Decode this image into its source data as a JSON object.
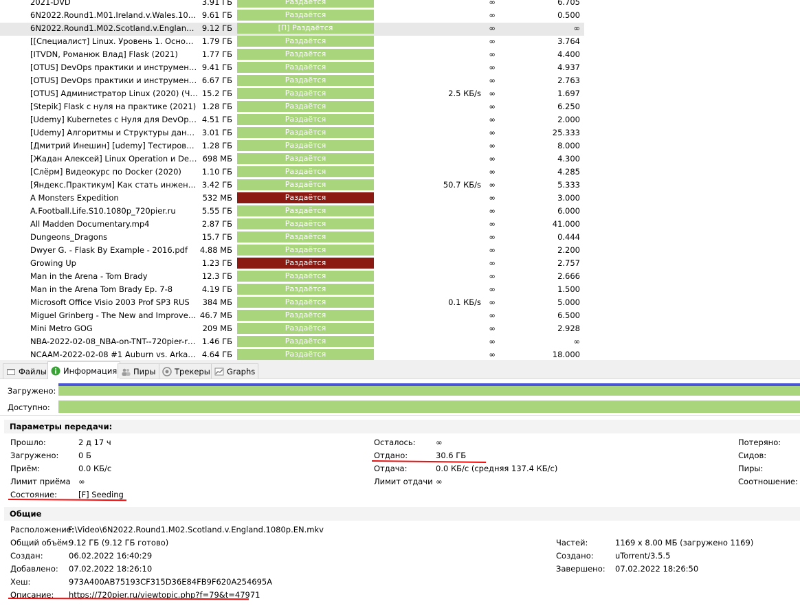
{
  "torrents": [
    {
      "name": "2021-DVD",
      "size": "3.91 ГБ",
      "status": "Раздаётся",
      "status_kind": "ok",
      "up": "",
      "eta": "∞",
      "ratio": "6.705"
    },
    {
      "name": "6N2022.Round1.M01.Ireland.v.Wales.1080p....",
      "size": "9.61 ГБ",
      "status": "Раздаётся",
      "status_kind": "ok",
      "up": "",
      "eta": "∞",
      "ratio": "0.500"
    },
    {
      "name": "6N2022.Round1.M02.Scotland.v.England.10...",
      "size": "9.12 ГБ",
      "status": "[П] Раздаётся",
      "status_kind": "ok",
      "up": "",
      "eta": "∞",
      "ratio": "∞",
      "selected": true
    },
    {
      "name": "[[Специалист] Linux. Уровень 1. Основы а...",
      "size": "1.79 ГБ",
      "status": "Раздаётся",
      "status_kind": "ok",
      "up": "",
      "eta": "∞",
      "ratio": "3.764"
    },
    {
      "name": "[ITVDN, Романюк Влад] Flask (2021)",
      "size": "1.77 ГБ",
      "status": "Раздаётся",
      "status_kind": "ok",
      "up": "",
      "eta": "∞",
      "ratio": "4.400"
    },
    {
      "name": "[OTUS] DevOps практики и инструменты",
      "size": "9.41 ГБ",
      "status": "Раздаётся",
      "status_kind": "ok",
      "up": "",
      "eta": "∞",
      "ratio": "4.937"
    },
    {
      "name": "[OTUS] DevOps практики и инструменты (...",
      "size": "6.67 ГБ",
      "status": "Раздаётся",
      "status_kind": "ok",
      "up": "",
      "eta": "∞",
      "ratio": "2.763"
    },
    {
      "name": "[OTUS] Администратор Linux (2020) (Часть...",
      "size": "15.2 ГБ",
      "status": "Раздаётся",
      "status_kind": "ok",
      "up": "2.5 КБ/s",
      "eta": "∞",
      "ratio": "1.697"
    },
    {
      "name": "[Stepik] Flask с нуля на практике (2021)",
      "size": "1.28 ГБ",
      "status": "Раздаётся",
      "status_kind": "ok",
      "up": "",
      "eta": "∞",
      "ratio": "6.250"
    },
    {
      "name": "[Udemy] Kubernetes с Нуля для DevOps И...",
      "size": "4.51 ГБ",
      "status": "Раздаётся",
      "status_kind": "ok",
      "up": "",
      "eta": "∞",
      "ratio": "2.000"
    },
    {
      "name": "[Udemy] Алгоритмы и Структуры данных ...",
      "size": "3.01 ГБ",
      "status": "Раздаётся",
      "status_kind": "ok",
      "up": "",
      "eta": "∞",
      "ratio": "25.333"
    },
    {
      "name": "[Дмитрий Инешин] [udemy] Тестировани...",
      "size": "1.28 ГБ",
      "status": "Раздаётся",
      "status_kind": "ok",
      "up": "",
      "eta": "∞",
      "ratio": "8.000"
    },
    {
      "name": "[Жадан Алексей] Linux Operation и DevOp...",
      "size": "698 МБ",
      "status": "Раздаётся",
      "status_kind": "ok",
      "up": "",
      "eta": "∞",
      "ratio": "4.300"
    },
    {
      "name": "[Слёрм] Видеокурс по Docker (2020)",
      "size": "1.10 ГБ",
      "status": "Раздаётся",
      "status_kind": "ok",
      "up": "",
      "eta": "∞",
      "ratio": "4.285"
    },
    {
      "name": "[Яндекс.Практикум] Как стать инженером...",
      "size": "3.42 ГБ",
      "status": "Раздаётся",
      "status_kind": "ok",
      "up": "50.7 КБ/s",
      "eta": "∞",
      "ratio": "5.333"
    },
    {
      "name": "A Monsters Expedition",
      "size": "532 МБ",
      "status": "Раздаётся",
      "status_kind": "err",
      "up": "",
      "eta": "∞",
      "ratio": "3.000"
    },
    {
      "name": "A.Football.Life.S10.1080p_720pier.ru",
      "size": "5.55 ГБ",
      "status": "Раздаётся",
      "status_kind": "ok",
      "up": "",
      "eta": "∞",
      "ratio": "6.000"
    },
    {
      "name": "All Madden Documentary.mp4",
      "size": "2.87 ГБ",
      "status": "Раздаётся",
      "status_kind": "ok",
      "up": "",
      "eta": "∞",
      "ratio": "41.000"
    },
    {
      "name": "Dungeons_Dragons",
      "size": "15.7 ГБ",
      "status": "Раздаётся",
      "status_kind": "ok",
      "up": "",
      "eta": "∞",
      "ratio": "0.444"
    },
    {
      "name": "Dwyer G. - Flask By Example - 2016.pdf",
      "size": "4.88 МБ",
      "status": "Раздаётся",
      "status_kind": "ok",
      "up": "",
      "eta": "∞",
      "ratio": "2.200"
    },
    {
      "name": "Growing Up",
      "size": "1.23 ГБ",
      "status": "Раздаётся",
      "status_kind": "err",
      "up": "",
      "eta": "∞",
      "ratio": "2.757"
    },
    {
      "name": "Man in the Arena - Tom Brady",
      "size": "12.3 ГБ",
      "status": "Раздаётся",
      "status_kind": "ok",
      "up": "",
      "eta": "∞",
      "ratio": "2.666"
    },
    {
      "name": "Man in the Arena Tom Brady  Ep. 7-8",
      "size": "4.19 ГБ",
      "status": "Раздаётся",
      "status_kind": "ok",
      "up": "",
      "eta": "∞",
      "ratio": "1.500"
    },
    {
      "name": "Microsoft Office Visio 2003 Prof SP3 RUS",
      "size": "384 МБ",
      "status": "Раздаётся",
      "status_kind": "ok",
      "up": "0.1 КБ/s",
      "eta": "∞",
      "ratio": "5.000"
    },
    {
      "name": "Miguel Grinberg - The New and Improved Fl...",
      "size": "46.7 МБ",
      "status": "Раздаётся",
      "status_kind": "ok",
      "up": "",
      "eta": "∞",
      "ratio": "6.500"
    },
    {
      "name": "Mini Metro GOG",
      "size": "209 МБ",
      "status": "Раздаётся",
      "status_kind": "ok",
      "up": "",
      "eta": "∞",
      "ratio": "2.928"
    },
    {
      "name": "NBA-2022-02-08_NBA-on-TNT--720pier-ru....",
      "size": "1.46 ГБ",
      "status": "Раздаётся",
      "status_kind": "ok",
      "up": "",
      "eta": "∞",
      "ratio": "∞"
    },
    {
      "name": "NCAAM-2022-02-08 #1 Auburn vs. Arkansa...",
      "size": "4.64 ГБ",
      "status": "Раздаётся",
      "status_kind": "ok",
      "up": "",
      "eta": "∞",
      "ratio": "18.000"
    }
  ],
  "tabs": [
    {
      "label": "Файлы",
      "icon": "files-icon"
    },
    {
      "label": "Информация",
      "icon": "info-icon",
      "active": true
    },
    {
      "label": "Пиры",
      "icon": "peers-icon"
    },
    {
      "label": "Трекеры",
      "icon": "trackers-icon"
    },
    {
      "label": "Graphs",
      "icon": "graphs-icon"
    }
  ],
  "progress": {
    "downloaded_label": "Загружено:",
    "available_label": "Доступно:",
    "downloaded_fraction": 1.0,
    "available_fraction": 1.0
  },
  "transfer": {
    "title": "Параметры передачи:",
    "elapsed_label": "Прошло:",
    "elapsed": "2 д 17 ч",
    "downloaded_label": "Загружено:",
    "downloaded": "0 Б",
    "receive_label": "Приём:",
    "receive": "0.0 КБ/с",
    "receive_limit_label": "Лимит приёма",
    "receive_limit": "∞",
    "state_label": "Состояние:",
    "state": "[F] Seeding",
    "remaining_label": "Осталось:",
    "remaining": "∞",
    "uploaded_label": "Отдано:",
    "uploaded": "30.6 ГБ",
    "upload_label": "Отдача:",
    "upload": "0.0 КБ/с (средняя 137.4 КБ/с)",
    "upload_limit_label": "Лимит отдачи",
    "upload_limit": "∞",
    "lost_label": "Потеряно:",
    "seeds_label": "Сидов:",
    "peers_label": "Пиры:",
    "ratio_label": "Соотношение:"
  },
  "general": {
    "title": "Общие",
    "location_label": "Расположение:",
    "location": "F:\\Video\\6N2022.Round1.M02.Scotland.v.England.1080p.EN.mkv",
    "total_label": "Общий объём:",
    "total": "9.12 ГБ (9.12 ГБ готово)",
    "created_label": "Создан:",
    "created": "06.02.2022 16:40:29",
    "added_label": "Добавлено:",
    "added": "07.02.2022 18:26:10",
    "hash_label": "Хеш:",
    "hash": "973A400AB75193CF315D36E84FB9F620A254695A",
    "description_label": "Описание:",
    "description": "https://720pier.ru/viewtopic.php?f=79&t=47971",
    "pieces_label": "Частей:",
    "pieces": "1169 x 8.00 МБ (загружено 1169)",
    "created_by_label": "Создано:",
    "created_by": "uTorrent/3.5.5",
    "completed_label": "Завершено:",
    "completed": "07.02.2022 18:26:50"
  },
  "colors": {
    "status_ok": "#a9d67c",
    "status_error": "#8b1a12",
    "progress_fill": "#a9d67c",
    "downloaded_stripe": "#4a55d8",
    "annotation": "#e81010"
  }
}
